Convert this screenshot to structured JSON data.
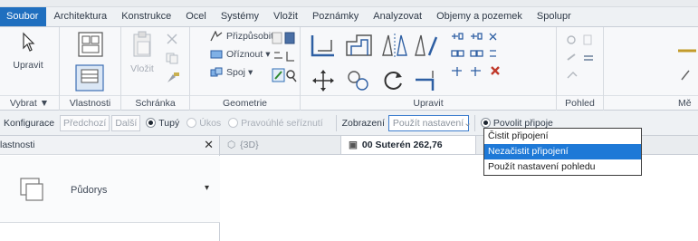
{
  "ribbon_tabs": [
    "Soubor",
    "Architektura",
    "Konstrukce",
    "Ocel",
    "Systémy",
    "Vložit",
    "Poznámky",
    "Analyzovat",
    "Objemy a pozemek",
    "Spolupr"
  ],
  "panels": {
    "select": {
      "modify_label": "Upravit",
      "footer_label": "Vybrat ▼"
    },
    "properties": {
      "footer_label": "Vlastnosti"
    },
    "clipboard": {
      "paste_label": "Vložit",
      "footer_label": "Schránka"
    },
    "geometry": {
      "cope": "Přizpůsobit",
      "cut": "Oříznout",
      "join": "Spoj",
      "footer_label": "Geometrie"
    },
    "modify": {
      "footer_label": "Upravit"
    },
    "view": {
      "footer_label": "Pohled"
    },
    "measure": {
      "footer_label": "Mě"
    }
  },
  "options_bar": {
    "configuration_label": "Konfigurace",
    "previous_button": "Předchozí",
    "next_button": "Další",
    "radio_tupy": "Tupý",
    "radio_ukos": "Úkos",
    "radio_pravouhle": "Pravoúhlé seříznutí",
    "display_label": "Zobrazení",
    "display_value": "Použít nastavení",
    "radio_povolit": "Povolit připoje"
  },
  "dropdown_options": [
    "Čistit připojení",
    "Nezačistit připojení",
    "Použít nastavení pohledu"
  ],
  "dropdown_selected_index": 1,
  "properties_palette": {
    "title": "lastnosti",
    "type_name": "Půdorys"
  },
  "view_tabs": [
    {
      "label": "{3D}",
      "active": false
    },
    {
      "label": "00 Suterén 262,76",
      "active": true
    }
  ],
  "colors": {
    "file_tab": "#1f6fbf",
    "selection": "#1e79d7",
    "ribbon_bg": "#f7f8fa"
  }
}
